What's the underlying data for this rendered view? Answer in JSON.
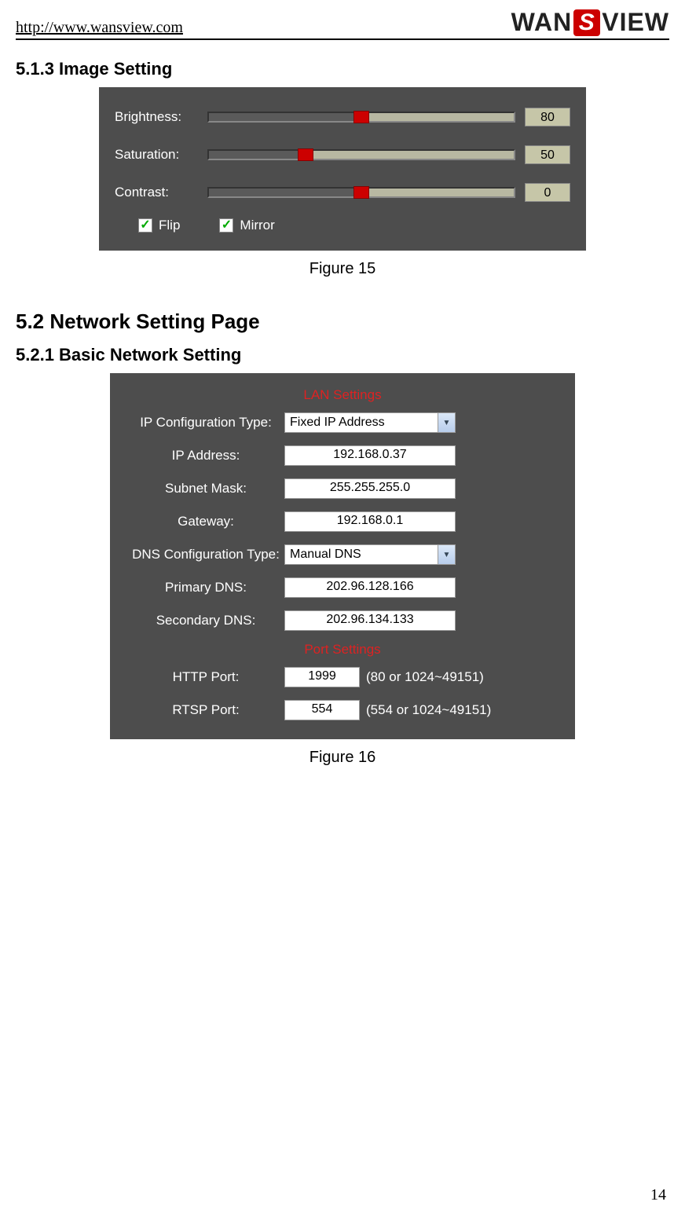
{
  "header": {
    "url": "http://www.wansview.com",
    "logo_text_1": "WAN",
    "logo_text_s": "S",
    "logo_text_2": "VIEW"
  },
  "section_513": "5.1.3   Image Setting",
  "figure15": {
    "caption": "Figure 15",
    "brightness_label": "Brightness:",
    "brightness_value": "80",
    "saturation_label": "Saturation:",
    "saturation_value": "50",
    "contrast_label": "Contrast:",
    "contrast_value": "0",
    "flip_label": "Flip",
    "mirror_label": "Mirror",
    "check_glyph": "✓"
  },
  "section_52": "5.2   Network Setting Page",
  "section_521": "5.2.1   Basic Network Setting",
  "figure16": {
    "caption": "Figure 16",
    "lan_settings_label": "LAN Settings",
    "ip_config_type_label": "IP Configuration Type:",
    "ip_config_type_value": "Fixed IP Address",
    "ip_address_label": "IP Address:",
    "ip_address_value": "192.168.0.37",
    "subnet_mask_label": "Subnet Mask:",
    "subnet_mask_value": "255.255.255.0",
    "gateway_label": "Gateway:",
    "gateway_value": "192.168.0.1",
    "dns_config_type_label": "DNS Configuration Type:",
    "dns_config_type_value": "Manual DNS",
    "primary_dns_label": "Primary DNS:",
    "primary_dns_value": "202.96.128.166",
    "secondary_dns_label": "Secondary DNS:",
    "secondary_dns_value": "202.96.134.133",
    "port_settings_label": "Port Settings",
    "http_port_label": "HTTP Port:",
    "http_port_value": "1999",
    "http_port_hint": "(80 or 1024~49151)",
    "rtsp_port_label": "RTSP Port:",
    "rtsp_port_value": "554",
    "rtsp_port_hint": "(554 or 1024~49151)"
  },
  "page_number": "14"
}
